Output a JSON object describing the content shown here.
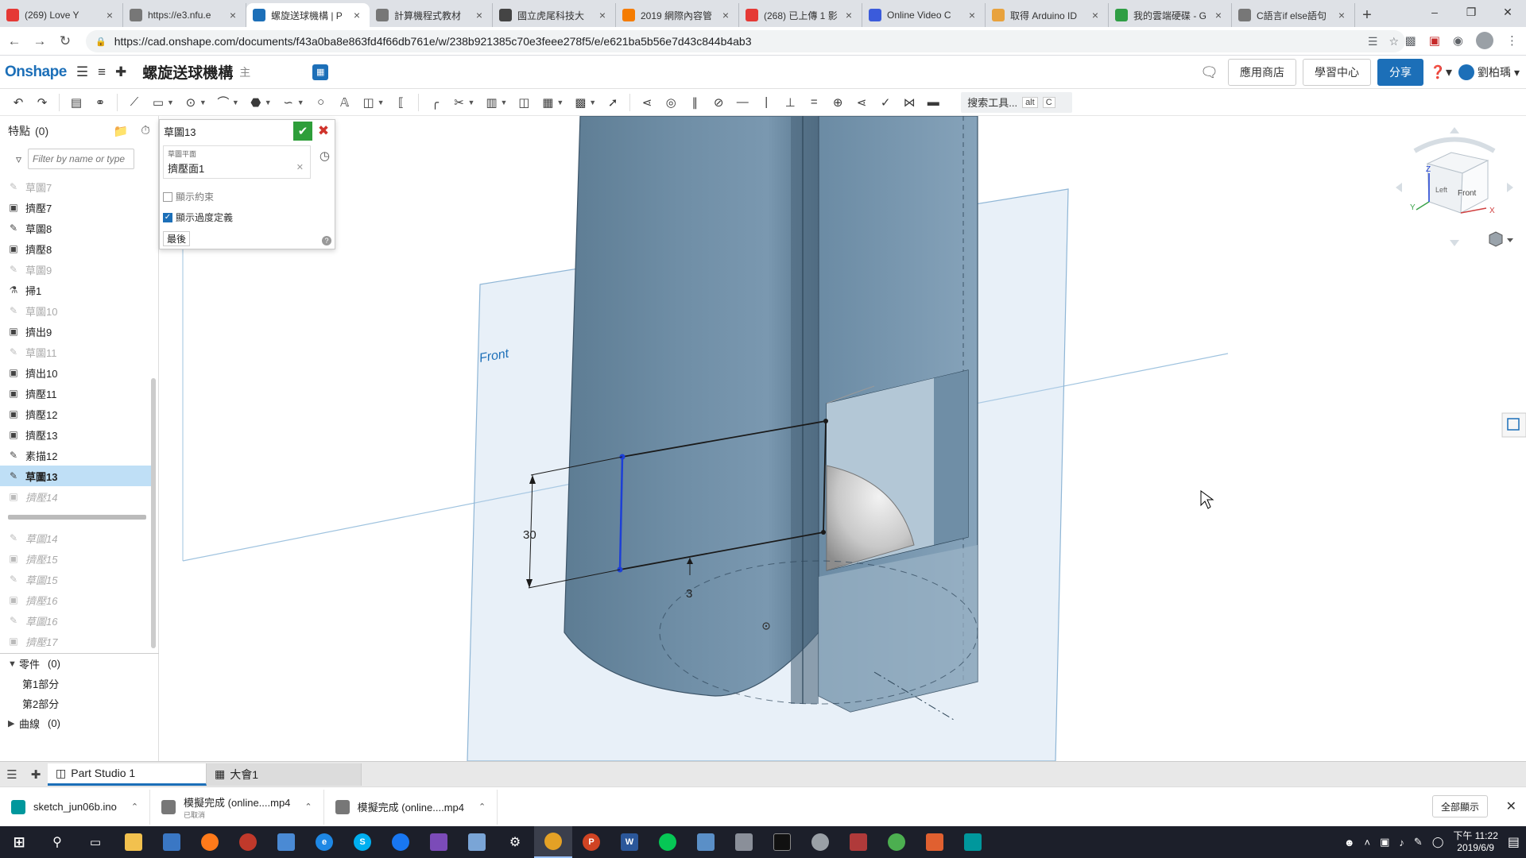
{
  "browser": {
    "tabs": [
      {
        "title": "(269) Love Y",
        "color": "#e53935",
        "active": false
      },
      {
        "title": "https://e3.nfu.e",
        "color": "#777777",
        "active": false
      },
      {
        "title": "螺旋送球機構 | P",
        "color": "#1c6fb8",
        "active": true
      },
      {
        "title": "計算機程式教材",
        "color": "#777777",
        "active": false
      },
      {
        "title": "國立虎尾科技大",
        "color": "#444444",
        "active": false
      },
      {
        "title": "2019 網際內容管",
        "color": "#f57c00",
        "active": false
      },
      {
        "title": "(268) 已上傳 1 影",
        "color": "#e53935",
        "active": false
      },
      {
        "title": "Online Video C",
        "color": "#3b5bdb",
        "active": false
      },
      {
        "title": "取得 Arduino ID",
        "color": "#e8a23d",
        "active": false
      },
      {
        "title": "我的雲端硬碟 - G",
        "color": "#2f9e44",
        "active": false
      },
      {
        "title": "C語言if else語句",
        "color": "#777777",
        "active": false
      }
    ],
    "url": "https://cad.onshape.com/documents/f43a0ba8e863fd4f66db761e/w/238b921385c70e3feee278f5/e/e621ba5b56e7d43c844b4ab3"
  },
  "onshape": {
    "logo": "Onshape",
    "document_title": "螺旋送球機構",
    "branch": "主",
    "app_store": "應用商店",
    "learning_center": "學習中心",
    "share": "分享",
    "user": "劉柏瑀",
    "search_tools": "搜索工具...",
    "search_kb1": "alt",
    "search_kb2": "C"
  },
  "feature_panel": {
    "title": "特點",
    "count": "(0)",
    "filter_placeholder": "Filter by name or type",
    "items": [
      {
        "label": "草圖7",
        "icon": "pencil",
        "state": "dim"
      },
      {
        "label": "擠壓7",
        "icon": "extrude",
        "state": "normal"
      },
      {
        "label": "草圖8",
        "icon": "pencil",
        "state": "normal"
      },
      {
        "label": "擠壓8",
        "icon": "extrude",
        "state": "normal"
      },
      {
        "label": "草圖9",
        "icon": "pencil",
        "state": "dim"
      },
      {
        "label": "掃1",
        "icon": "sweep",
        "state": "normal"
      },
      {
        "label": "草圖10",
        "icon": "pencil",
        "state": "dim"
      },
      {
        "label": "擠出9",
        "icon": "extrude",
        "state": "normal"
      },
      {
        "label": "草圖11",
        "icon": "pencil",
        "state": "dim"
      },
      {
        "label": "擠出10",
        "icon": "extrude",
        "state": "normal"
      },
      {
        "label": "擠壓11",
        "icon": "extrude",
        "state": "normal"
      },
      {
        "label": "擠壓12",
        "icon": "extrude",
        "state": "normal"
      },
      {
        "label": "擠壓13",
        "icon": "extrude",
        "state": "normal"
      },
      {
        "label": "素描12",
        "icon": "pencil",
        "state": "normal"
      },
      {
        "label": "草圖13",
        "icon": "pencil",
        "state": "selected"
      },
      {
        "label": "擠壓14",
        "icon": "extrude",
        "state": "rolled"
      }
    ],
    "rolled_items": [
      {
        "label": "草圖14",
        "icon": "pencil"
      },
      {
        "label": "擠壓15",
        "icon": "extrude"
      },
      {
        "label": "草圖15",
        "icon": "pencil"
      },
      {
        "label": "擠壓16",
        "icon": "extrude"
      },
      {
        "label": "草圖16",
        "icon": "pencil"
      },
      {
        "label": "擠壓17",
        "icon": "extrude"
      }
    ],
    "parts_label": "零件",
    "parts_count": "(0)",
    "parts": [
      "第1部分",
      "第2部分"
    ],
    "curves_label": "曲線",
    "curves_count": "(0)"
  },
  "sketch_dialog": {
    "name": "草圖13",
    "plane_label": "草圖平面",
    "plane_value": "擠壓面1",
    "show_constraints": "顯示約束",
    "show_constraints_checked": false,
    "show_overdefined": "顯示過度定義",
    "show_overdefined_checked": true,
    "final_button": "最後"
  },
  "viewport": {
    "plane_label": "Front",
    "dimension_vertical": "30",
    "dimension_horizontal": "3",
    "viewcube_front": "Front",
    "viewcube_left": "Left",
    "axis_x": "X",
    "axis_y": "Y",
    "axis_z": "Z"
  },
  "bottom_tabs": [
    {
      "label": "Part Studio 1",
      "icon": "part-studio",
      "active": true
    },
    {
      "label": "大會1",
      "icon": "assembly",
      "active": false
    }
  ],
  "downloads": [
    {
      "name": "sketch_jun06b.ino",
      "sub": "",
      "icon": "arduino",
      "color": "#00979c"
    },
    {
      "name": "模擬完成 (online....mp4",
      "sub": "已取消",
      "icon": "file",
      "color": "#777777"
    },
    {
      "name": "模擬完成 (online....mp4",
      "sub": "",
      "icon": "file",
      "color": "#777777"
    }
  ],
  "show_all": "全部顯示",
  "taskbar": {
    "time": "下午 11:22",
    "date": "2019/6/9"
  }
}
